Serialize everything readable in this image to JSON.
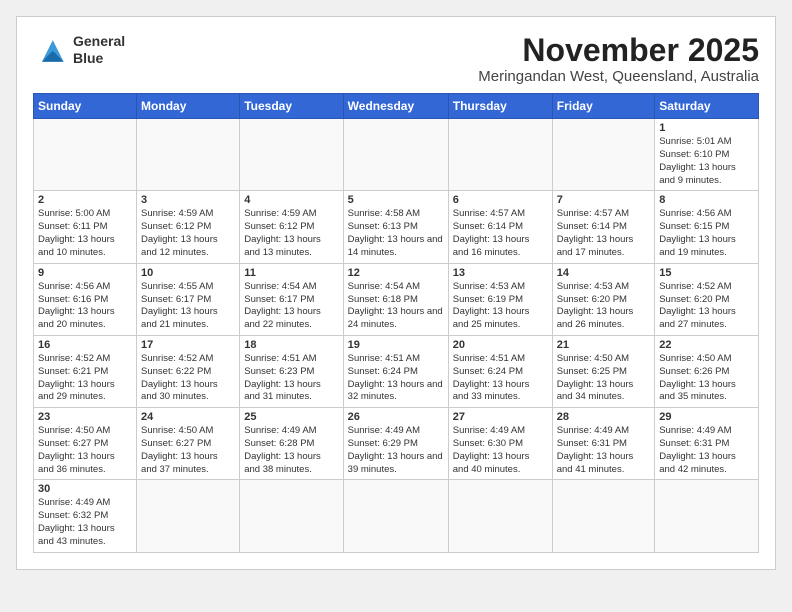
{
  "logo": {
    "line1": "General",
    "line2": "Blue"
  },
  "title": "November 2025",
  "location": "Meringandan West, Queensland, Australia",
  "days_of_week": [
    "Sunday",
    "Monday",
    "Tuesday",
    "Wednesday",
    "Thursday",
    "Friday",
    "Saturday"
  ],
  "weeks": [
    [
      {
        "day": "",
        "info": ""
      },
      {
        "day": "",
        "info": ""
      },
      {
        "day": "",
        "info": ""
      },
      {
        "day": "",
        "info": ""
      },
      {
        "day": "",
        "info": ""
      },
      {
        "day": "",
        "info": ""
      },
      {
        "day": "1",
        "info": "Sunrise: 5:01 AM\nSunset: 6:10 PM\nDaylight: 13 hours and 9 minutes."
      }
    ],
    [
      {
        "day": "2",
        "info": "Sunrise: 5:00 AM\nSunset: 6:11 PM\nDaylight: 13 hours and 10 minutes."
      },
      {
        "day": "3",
        "info": "Sunrise: 4:59 AM\nSunset: 6:12 PM\nDaylight: 13 hours and 12 minutes."
      },
      {
        "day": "4",
        "info": "Sunrise: 4:59 AM\nSunset: 6:12 PM\nDaylight: 13 hours and 13 minutes."
      },
      {
        "day": "5",
        "info": "Sunrise: 4:58 AM\nSunset: 6:13 PM\nDaylight: 13 hours and 14 minutes."
      },
      {
        "day": "6",
        "info": "Sunrise: 4:57 AM\nSunset: 6:14 PM\nDaylight: 13 hours and 16 minutes."
      },
      {
        "day": "7",
        "info": "Sunrise: 4:57 AM\nSunset: 6:14 PM\nDaylight: 13 hours and 17 minutes."
      },
      {
        "day": "8",
        "info": "Sunrise: 4:56 AM\nSunset: 6:15 PM\nDaylight: 13 hours and 19 minutes."
      }
    ],
    [
      {
        "day": "9",
        "info": "Sunrise: 4:56 AM\nSunset: 6:16 PM\nDaylight: 13 hours and 20 minutes."
      },
      {
        "day": "10",
        "info": "Sunrise: 4:55 AM\nSunset: 6:17 PM\nDaylight: 13 hours and 21 minutes."
      },
      {
        "day": "11",
        "info": "Sunrise: 4:54 AM\nSunset: 6:17 PM\nDaylight: 13 hours and 22 minutes."
      },
      {
        "day": "12",
        "info": "Sunrise: 4:54 AM\nSunset: 6:18 PM\nDaylight: 13 hours and 24 minutes."
      },
      {
        "day": "13",
        "info": "Sunrise: 4:53 AM\nSunset: 6:19 PM\nDaylight: 13 hours and 25 minutes."
      },
      {
        "day": "14",
        "info": "Sunrise: 4:53 AM\nSunset: 6:20 PM\nDaylight: 13 hours and 26 minutes."
      },
      {
        "day": "15",
        "info": "Sunrise: 4:52 AM\nSunset: 6:20 PM\nDaylight: 13 hours and 27 minutes."
      }
    ],
    [
      {
        "day": "16",
        "info": "Sunrise: 4:52 AM\nSunset: 6:21 PM\nDaylight: 13 hours and 29 minutes."
      },
      {
        "day": "17",
        "info": "Sunrise: 4:52 AM\nSunset: 6:22 PM\nDaylight: 13 hours and 30 minutes."
      },
      {
        "day": "18",
        "info": "Sunrise: 4:51 AM\nSunset: 6:23 PM\nDaylight: 13 hours and 31 minutes."
      },
      {
        "day": "19",
        "info": "Sunrise: 4:51 AM\nSunset: 6:24 PM\nDaylight: 13 hours and 32 minutes."
      },
      {
        "day": "20",
        "info": "Sunrise: 4:51 AM\nSunset: 6:24 PM\nDaylight: 13 hours and 33 minutes."
      },
      {
        "day": "21",
        "info": "Sunrise: 4:50 AM\nSunset: 6:25 PM\nDaylight: 13 hours and 34 minutes."
      },
      {
        "day": "22",
        "info": "Sunrise: 4:50 AM\nSunset: 6:26 PM\nDaylight: 13 hours and 35 minutes."
      }
    ],
    [
      {
        "day": "23",
        "info": "Sunrise: 4:50 AM\nSunset: 6:27 PM\nDaylight: 13 hours and 36 minutes."
      },
      {
        "day": "24",
        "info": "Sunrise: 4:50 AM\nSunset: 6:27 PM\nDaylight: 13 hours and 37 minutes."
      },
      {
        "day": "25",
        "info": "Sunrise: 4:49 AM\nSunset: 6:28 PM\nDaylight: 13 hours and 38 minutes."
      },
      {
        "day": "26",
        "info": "Sunrise: 4:49 AM\nSunset: 6:29 PM\nDaylight: 13 hours and 39 minutes."
      },
      {
        "day": "27",
        "info": "Sunrise: 4:49 AM\nSunset: 6:30 PM\nDaylight: 13 hours and 40 minutes."
      },
      {
        "day": "28",
        "info": "Sunrise: 4:49 AM\nSunset: 6:31 PM\nDaylight: 13 hours and 41 minutes."
      },
      {
        "day": "29",
        "info": "Sunrise: 4:49 AM\nSunset: 6:31 PM\nDaylight: 13 hours and 42 minutes."
      }
    ],
    [
      {
        "day": "30",
        "info": "Sunrise: 4:49 AM\nSunset: 6:32 PM\nDaylight: 13 hours and 43 minutes."
      },
      {
        "day": "",
        "info": ""
      },
      {
        "day": "",
        "info": ""
      },
      {
        "day": "",
        "info": ""
      },
      {
        "day": "",
        "info": ""
      },
      {
        "day": "",
        "info": ""
      },
      {
        "day": "",
        "info": ""
      }
    ]
  ]
}
